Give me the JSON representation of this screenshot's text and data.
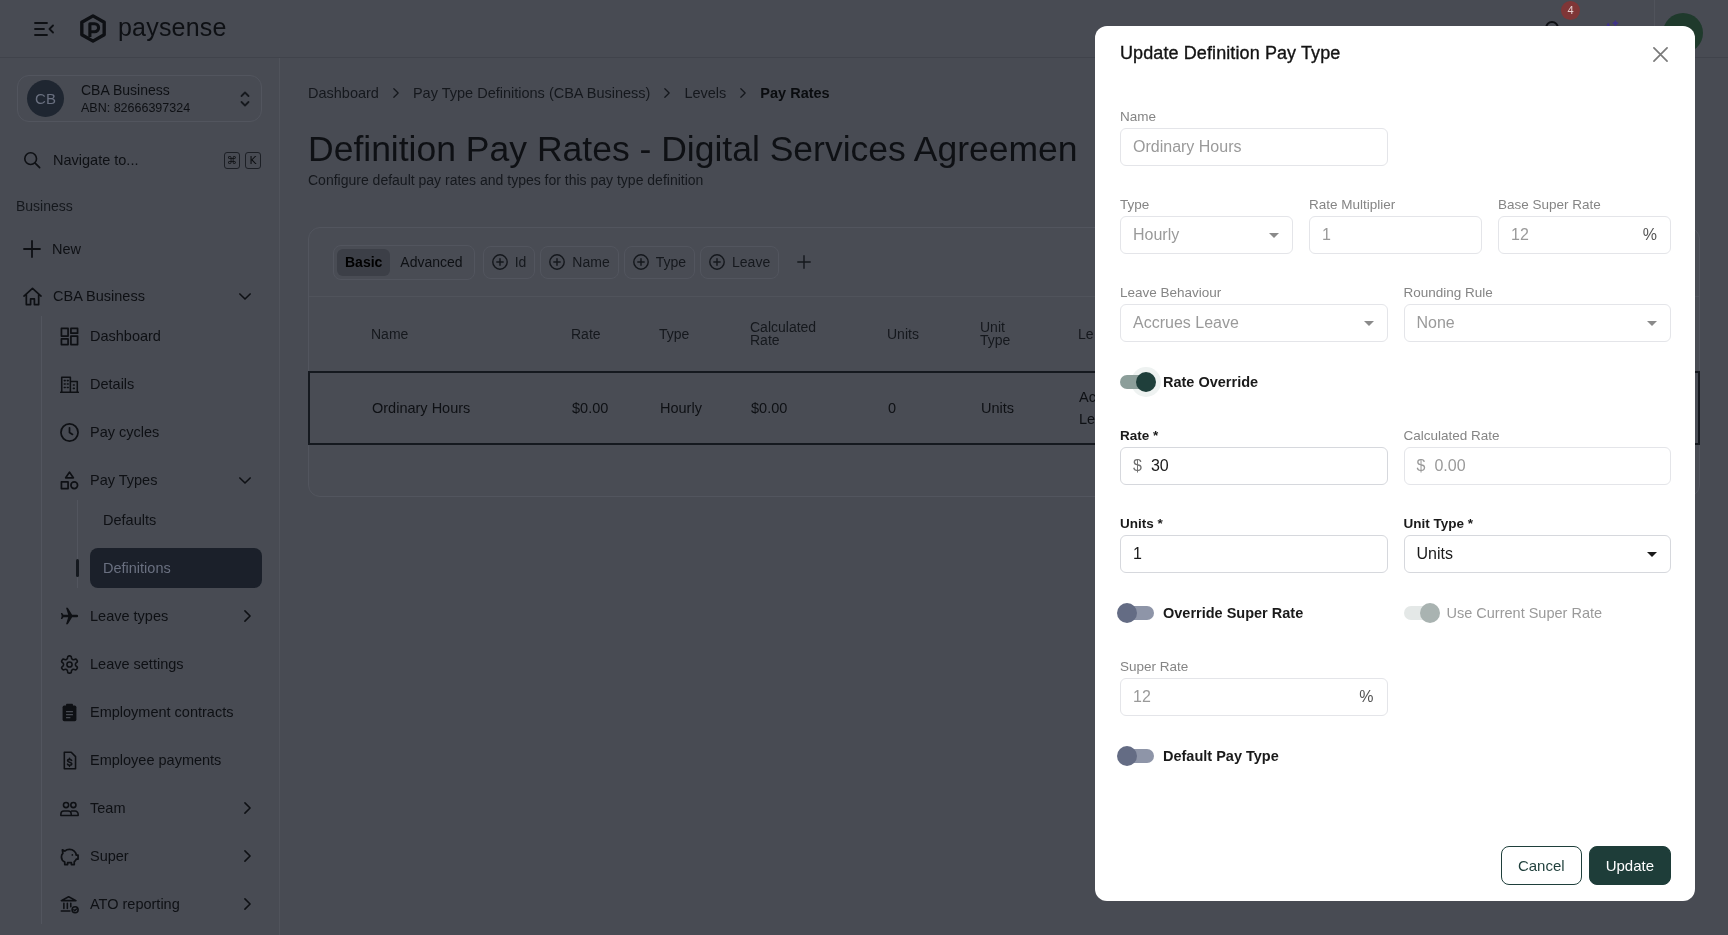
{
  "topbar": {
    "brand": "paysense",
    "notifications": "4"
  },
  "sidebar": {
    "account": {
      "initials": "CB",
      "name": "CBA Business",
      "abn": "ABN: 82666397324"
    },
    "search": {
      "placeholder": "Navigate to...",
      "keys": [
        "⌘",
        "K"
      ]
    },
    "section": "Business",
    "new_item": {
      "label": "New"
    },
    "nav": [
      {
        "label": "CBA Business",
        "kind": "group",
        "expanded": true,
        "selected": false,
        "children": [
          {
            "label": "Dashboard",
            "kind": "link",
            "selected": false
          },
          {
            "label": "Details",
            "kind": "link",
            "selected": false
          },
          {
            "label": "Pay cycles",
            "kind": "link",
            "selected": false
          },
          {
            "label": "Pay Types",
            "kind": "group",
            "expanded": true,
            "selected": false,
            "children": [
              {
                "label": "Defaults",
                "selected": false
              },
              {
                "label": "Definitions",
                "selected": true
              }
            ]
          },
          {
            "label": "Leave types",
            "kind": "group",
            "expanded": false,
            "selected": false
          },
          {
            "label": "Leave settings",
            "kind": "link",
            "selected": false
          },
          {
            "label": "Employment contracts",
            "kind": "link",
            "selected": false
          },
          {
            "label": "Employee payments",
            "kind": "link",
            "selected": false
          },
          {
            "label": "Team",
            "kind": "group",
            "expanded": false,
            "selected": false
          },
          {
            "label": "Super",
            "kind": "group",
            "expanded": false,
            "selected": false
          },
          {
            "label": "ATO reporting",
            "kind": "group",
            "expanded": false,
            "selected": false
          }
        ]
      }
    ]
  },
  "page": {
    "breadcrumb": [
      {
        "label": "Dashboard",
        "current": false
      },
      {
        "label": "Pay Type Definitions (CBA Business)",
        "current": false
      },
      {
        "label": "Levels",
        "current": false
      },
      {
        "label": "Pay Rates",
        "current": true
      }
    ],
    "title": "Definition Pay Rates - Digital Services Agreemen",
    "subtitle": "Configure default pay rates and types for this pay type definition"
  },
  "table": {
    "views": [
      {
        "label": "Basic",
        "selected": true
      },
      {
        "label": "Advanced",
        "selected": false
      }
    ],
    "filters": [
      "Id",
      "Name",
      "Type",
      "Leave"
    ],
    "columns": [
      "Name",
      "Rate",
      "Type",
      "Calculated Rate",
      "Units",
      "Unit Type",
      "Le"
    ],
    "rows": [
      {
        "selected": true,
        "cells": [
          "Ordinary Hours",
          "$0.00",
          "Hourly",
          "$0.00",
          "0",
          "Units",
          "Ac Le"
        ]
      }
    ]
  },
  "dialog": {
    "title": "Update Definition Pay Type",
    "rows": [
      {
        "fields": [
          {
            "kind": "text",
            "label": "Name",
            "value": "Ordinary Hours",
            "disabled": true
          }
        ]
      },
      {
        "fields": [
          {
            "kind": "select",
            "label": "Type",
            "value": "Hourly",
            "disabled": true
          },
          {
            "kind": "text",
            "label": "Rate Multiplier",
            "value": "1",
            "disabled": true
          },
          {
            "kind": "text",
            "label": "Base Super Rate",
            "value": "12",
            "suffix": "%",
            "disabled": true
          }
        ]
      },
      {
        "fields": [
          {
            "kind": "select",
            "label": "Leave Behaviour",
            "value": "Accrues Leave",
            "disabled": true
          },
          {
            "kind": "select",
            "label": "Rounding Rule",
            "value": "None",
            "disabled": true
          }
        ]
      },
      {
        "fields": [
          {
            "kind": "toggle",
            "label": "Rate Override",
            "on": true,
            "disabled": false,
            "focused": true
          }
        ]
      },
      {
        "fields": [
          {
            "kind": "text",
            "label": "Rate *",
            "prefix": "$",
            "value": "30",
            "disabled": false
          },
          {
            "kind": "text",
            "label": "Calculated Rate",
            "prefix": "$",
            "value": "0.00",
            "disabled": true
          }
        ]
      },
      {
        "fields": [
          {
            "kind": "text",
            "label": "Units *",
            "value": "1",
            "disabled": false
          },
          {
            "kind": "select",
            "label": "Unit Type *",
            "value": "Units",
            "disabled": false
          }
        ]
      },
      {
        "fields": [
          {
            "kind": "toggle",
            "label": "Override Super Rate",
            "on": false,
            "disabled": false,
            "focused": false
          },
          {
            "kind": "toggle",
            "label": "Use Current Super Rate",
            "on": true,
            "disabled": true,
            "focused": false
          }
        ]
      },
      {
        "fields": [
          {
            "kind": "text",
            "label": "Super Rate",
            "value": "12",
            "suffix": "%",
            "disabled": true
          }
        ]
      },
      {
        "fields": [
          {
            "kind": "toggle",
            "label": "Default Pay Type",
            "on": false,
            "disabled": false,
            "focused": false
          }
        ]
      }
    ],
    "buttons": [
      {
        "label": "Cancel",
        "kind": "secondary"
      },
      {
        "label": "Update",
        "kind": "primary"
      }
    ]
  }
}
